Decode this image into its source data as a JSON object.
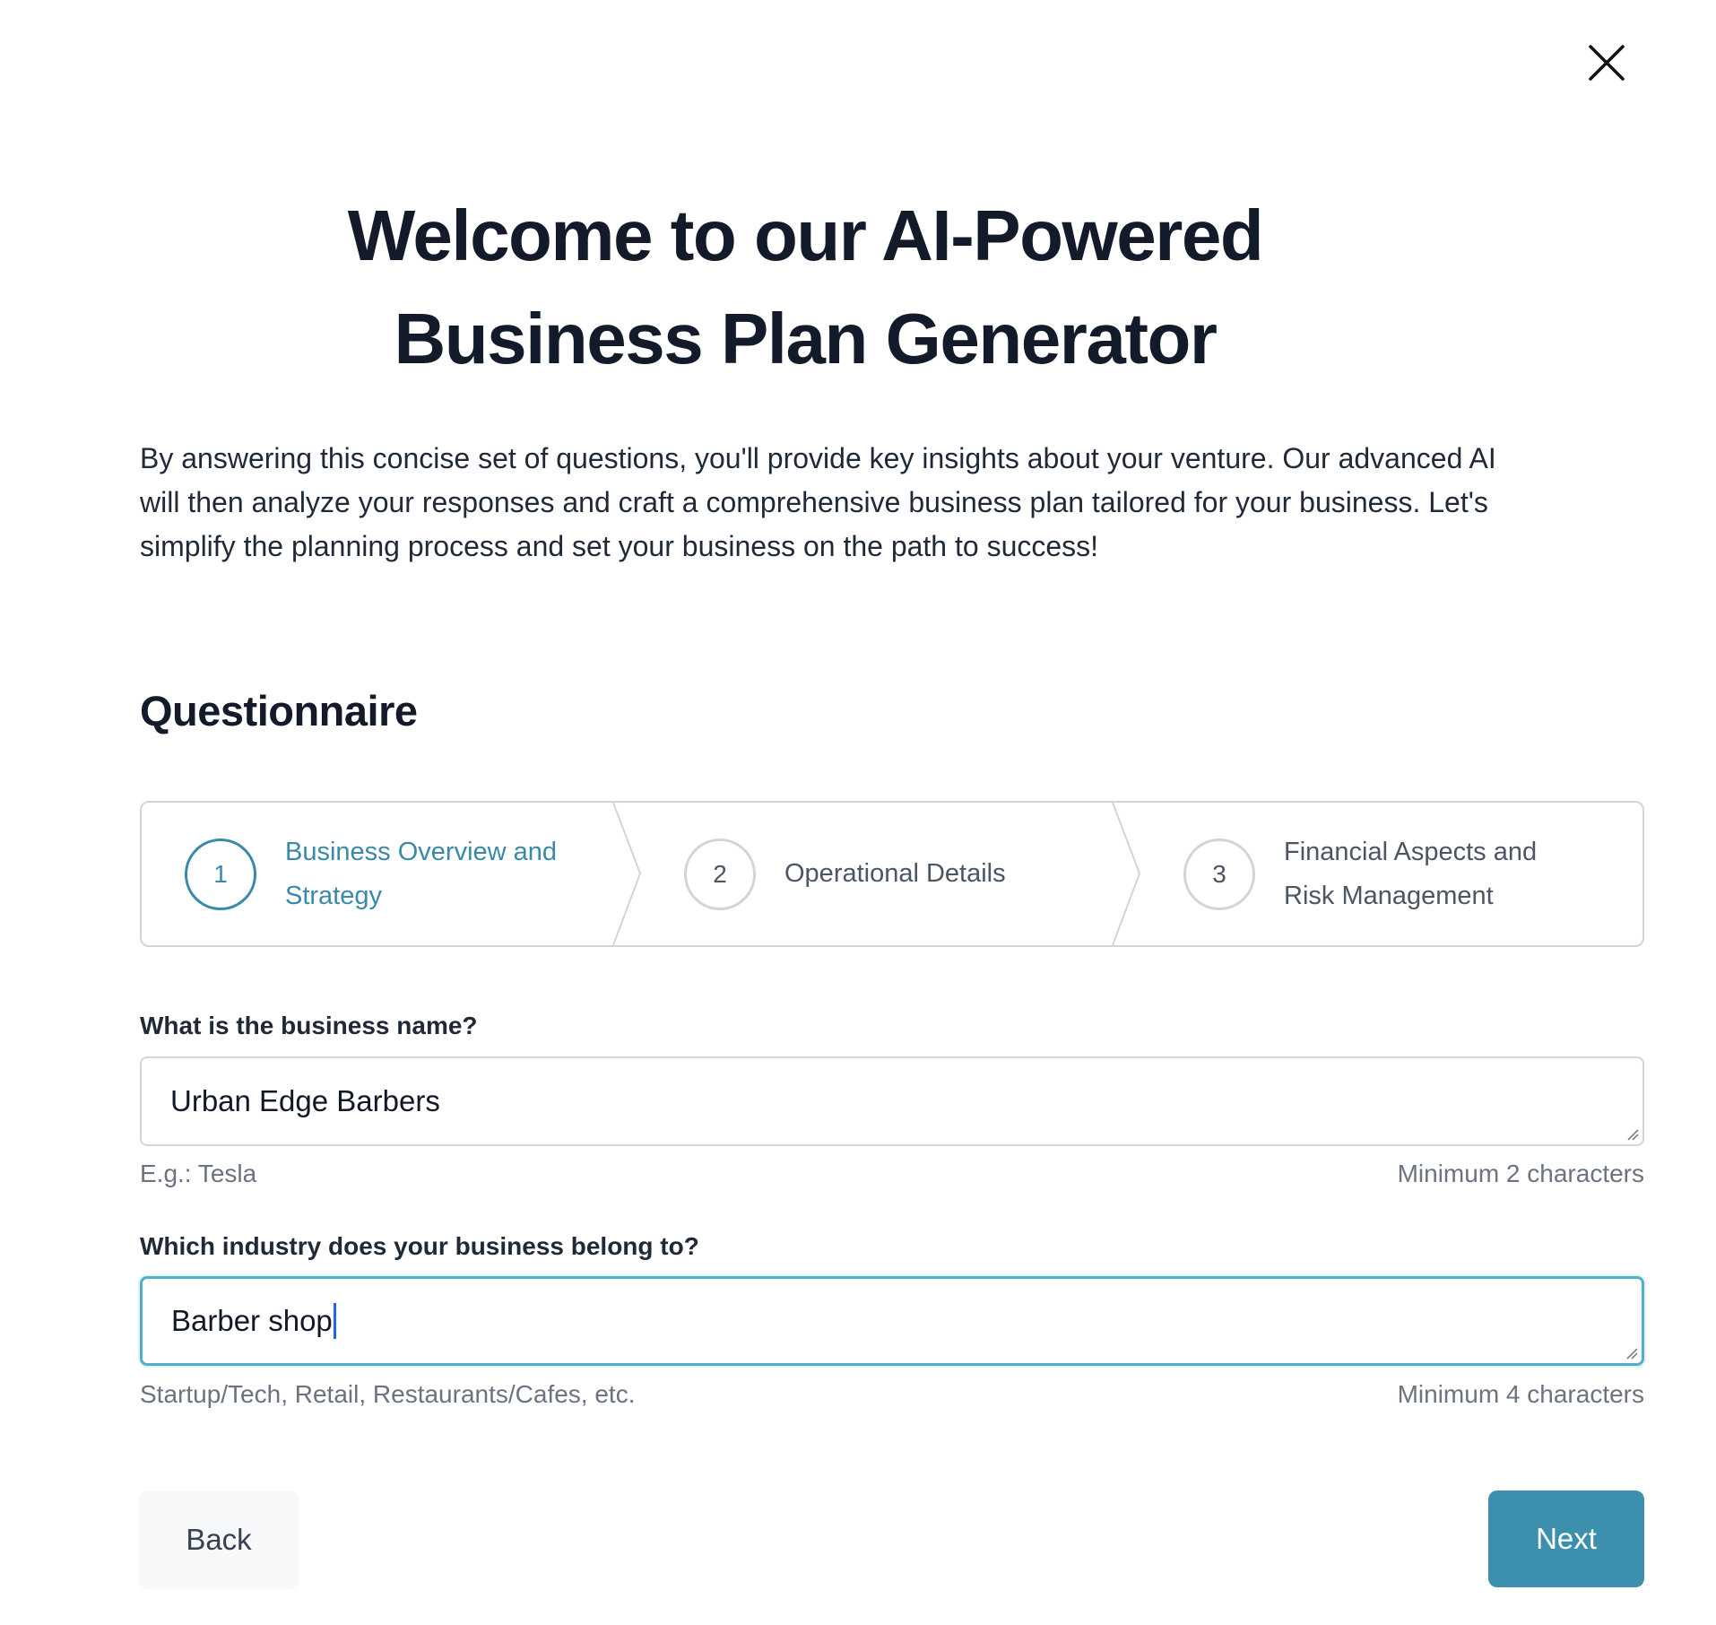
{
  "header": {
    "title_line1": "Welcome to our AI-Powered",
    "title_line2": "Business Plan Generator",
    "close_label": "Close"
  },
  "intro": {
    "line1": "By answering this concise set of questions, you'll provide key insights about your venture. Our advanced AI",
    "line2": "will then analyze your responses and craft a comprehensive business plan tailored for your business. Let's",
    "line3": "simplify the planning process and set your business on the path to success!"
  },
  "questionnaire": {
    "title": "Questionnaire",
    "steps": [
      {
        "number": "1",
        "line1": "Business Overview and",
        "line2": "Strategy",
        "active": true
      },
      {
        "number": "2",
        "line1": "Operational Details",
        "line2": "",
        "active": false
      },
      {
        "number": "3",
        "line1": "Financial Aspects and",
        "line2": "Risk Management",
        "active": false
      }
    ]
  },
  "fields": [
    {
      "label": "What is the business name?",
      "value": "Urban Edge Barbers",
      "hint_left": "E.g.: Tesla",
      "hint_right": "Minimum 2 characters",
      "focused": false
    },
    {
      "label": "Which industry does your business belong to?",
      "value": "Barber shop",
      "hint_left": "Startup/Tech, Retail, Restaurants/Cafes, etc.",
      "hint_right": "Minimum 4 characters",
      "focused": true
    }
  ],
  "actions": {
    "back_label": "Back",
    "next_label": "Next"
  },
  "colors": {
    "accent": "#3a89a8",
    "primary_button": "#3d8fae",
    "focus_border": "#4fb0cc",
    "border": "#d1d5db",
    "heading": "#131a2a"
  }
}
